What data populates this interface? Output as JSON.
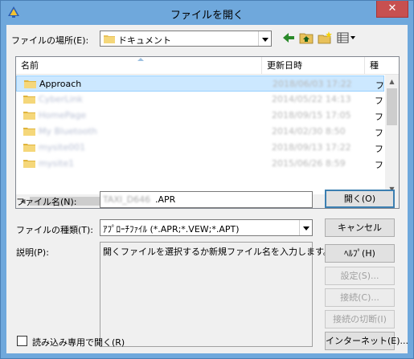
{
  "window": {
    "title": "ファイルを開く",
    "close_glyph": "✕",
    "accent": "#6fa8dc"
  },
  "location": {
    "label": "ファイルの場所(E):",
    "value": "ドキュメント"
  },
  "toolbar": {
    "icons": [
      "back-arrow-icon",
      "up-folder-icon",
      "new-folder-icon",
      "view-menu-icon"
    ]
  },
  "file_list": {
    "columns": [
      "名前",
      "更新日時",
      "種"
    ],
    "rows": [
      {
        "name": "Approach",
        "date": "2018/06/03 17:22",
        "type": "フ",
        "selected": true,
        "blurred_name": false
      },
      {
        "name": "CyberLink",
        "date": "2014/05/22 14:13",
        "type": "フ",
        "selected": false,
        "blurred_name": true
      },
      {
        "name": "HomePage",
        "date": "2018/09/15 17:05",
        "type": "フ",
        "selected": false,
        "blurred_name": true
      },
      {
        "name": "My Bluetooth",
        "date": "2014/02/30 8:50",
        "type": "フ",
        "selected": false,
        "blurred_name": true
      },
      {
        "name": "mysite001",
        "date": "2018/09/13 17:22",
        "type": "フ",
        "selected": false,
        "blurred_name": true
      },
      {
        "name": "mysite1",
        "date": "2015/06/26 8:59",
        "type": "フ",
        "selected": false,
        "blurred_name": true
      }
    ]
  },
  "filename": {
    "label": "ファイル名(N):",
    "value_blurred": "TAXI_D646",
    "value_suffix": ".APR"
  },
  "filetype": {
    "label": "ファイルの種類(T):",
    "value": "ｱﾌﾟﾛｰﾁﾌｧｲﾙ (*.APR;*.VEW;*.APT)"
  },
  "description": {
    "label": "説明(P):",
    "text": "開くファイルを選択するか新規ファイル名を入力します。"
  },
  "readonly_checkbox": {
    "label": "読み込み専用で開く(R)"
  },
  "buttons": {
    "open": "開く(O)",
    "cancel": "キャンセル",
    "help": "ﾍﾙﾌﾟ(H)",
    "settings": "設定(S)...",
    "connect": "接続(C)...",
    "disconnect": "接続の切断(I)",
    "internet": "インターネット(E)..."
  }
}
